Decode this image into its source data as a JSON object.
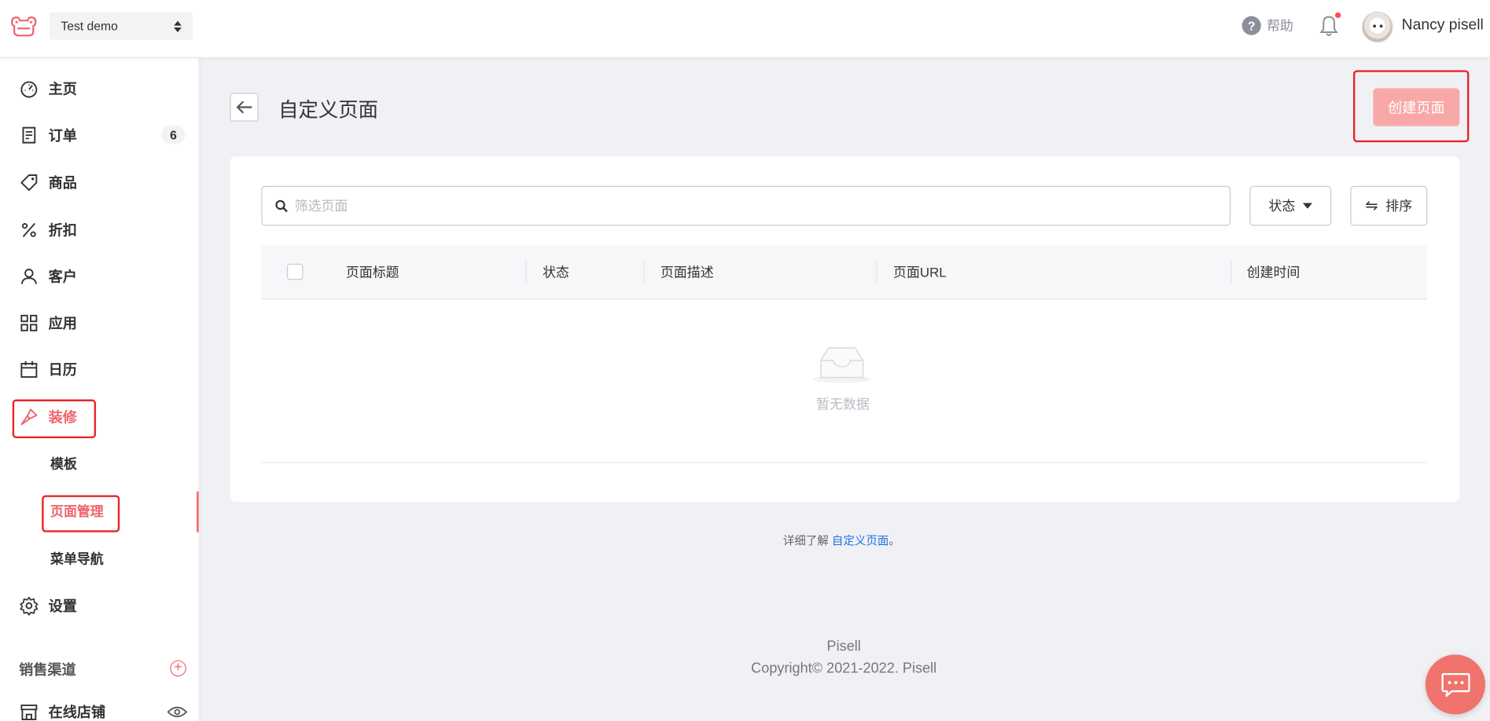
{
  "header": {
    "store_name": "Test demo",
    "help_label": "帮助",
    "user_name": "Nancy pisell"
  },
  "sidebar": {
    "items": [
      {
        "label": "主页",
        "icon": "dashboard-icon"
      },
      {
        "label": "订单",
        "icon": "order-icon",
        "badge": "6"
      },
      {
        "label": "商品",
        "icon": "tag-icon"
      },
      {
        "label": "折扣",
        "icon": "percent-icon"
      },
      {
        "label": "客户",
        "icon": "user-icon"
      },
      {
        "label": "应用",
        "icon": "apps-icon"
      },
      {
        "label": "日历",
        "icon": "calendar-icon"
      },
      {
        "label": "装修",
        "icon": "brush-icon",
        "active": true
      },
      {
        "label": "设置",
        "icon": "gear-icon"
      }
    ],
    "sub_items": [
      {
        "label": "模板"
      },
      {
        "label": "页面管理",
        "active": true
      },
      {
        "label": "菜单导航"
      }
    ],
    "sales_channels_title": "销售渠道",
    "online_store_label": "在线店铺"
  },
  "main": {
    "title": "自定义页面",
    "create_button": "创建页面",
    "search_placeholder": "筛选页面",
    "status_filter": "状态",
    "sort_button": "排序",
    "columns": [
      "页面标题",
      "状态",
      "页面描述",
      "页面URL",
      "创建时间"
    ],
    "empty_text": "暂无数据",
    "learn_more_prefix": "详细了解 ",
    "learn_more_link": "自定义页面",
    "learn_more_suffix": "。"
  },
  "footer": {
    "brand": "Pisell",
    "copyright": "Copyright© 2021-2022. Pisell"
  },
  "colors": {
    "accent": "#f0646c",
    "create_button_bg": "#f8a9a7",
    "highlight_box": "#e8262c",
    "link": "#1a73e8"
  }
}
